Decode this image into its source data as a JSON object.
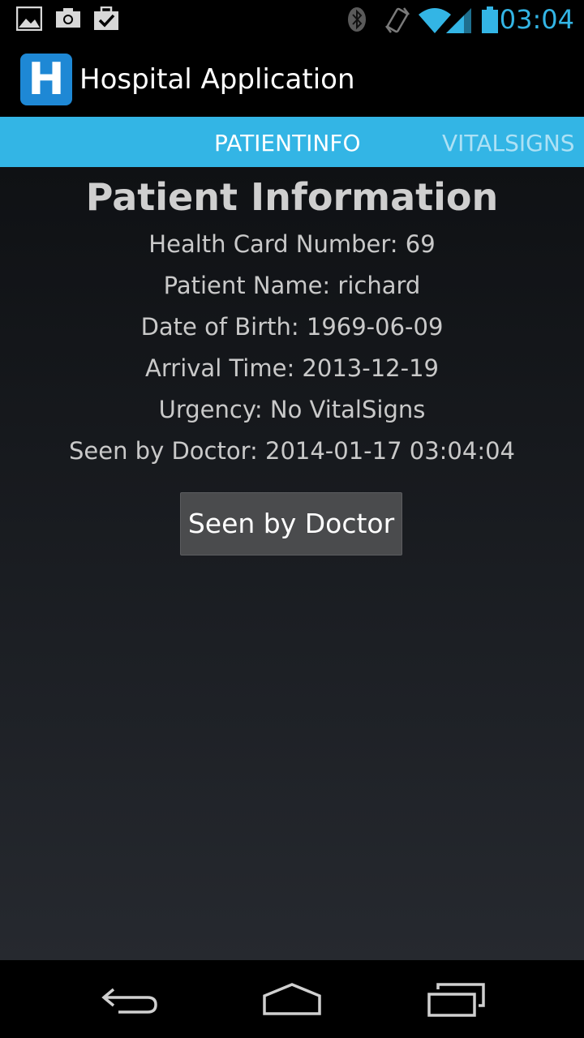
{
  "status_bar": {
    "time": "03:04",
    "accent_color": "#33b5e5",
    "left_icons": [
      "picture-icon",
      "camera-icon",
      "briefcase-check-icon"
    ],
    "right_icons": [
      "bluetooth-icon",
      "vibrate-icon",
      "wifi-icon",
      "signal-icon",
      "battery-icon"
    ]
  },
  "action_bar": {
    "logo_letter": "H",
    "title": "Hospital Application"
  },
  "tabs": [
    {
      "label": "PATIENTINFO",
      "active": true
    },
    {
      "label": "VITALSIGNS",
      "active": false
    }
  ],
  "patient": {
    "heading": "Patient Information",
    "health_card": "Health Card Number: 69",
    "name": "Patient Name: richard",
    "dob": "Date of Birth: 1969-06-09",
    "arrival": "Arrival Time: 2013-12-19",
    "urgency": "Urgency: No VitalSigns",
    "seen": "Seen by Doctor: 2014-01-17 03:04:04"
  },
  "seen_button_label": "Seen by Doctor",
  "nav_bar": {
    "icons": [
      "back-icon",
      "home-icon",
      "recent-apps-icon"
    ]
  }
}
